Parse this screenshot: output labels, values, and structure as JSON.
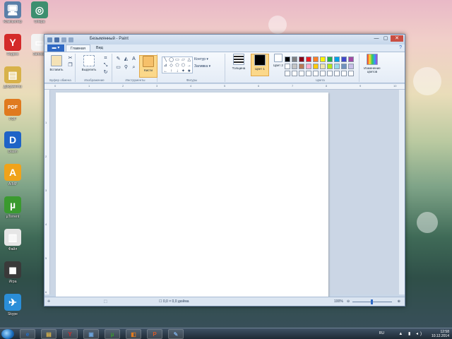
{
  "desktop": {
    "icons": [
      {
        "label": "Компьютер",
        "glyph": "🖥",
        "color": "#5a7fa8",
        "name": "computer"
      },
      {
        "label": "Яндекс",
        "glyph": "Y",
        "color": "#d42a2a",
        "name": "yandex"
      },
      {
        "label": "Документы",
        "glyph": "▤",
        "color": "#d8b24a",
        "name": "documents"
      },
      {
        "label": "PDF",
        "glyph": "PDF",
        "color": "#e07a1f",
        "name": "pdf"
      },
      {
        "label": "Daum",
        "glyph": "D",
        "color": "#1e63c7",
        "name": "daum"
      },
      {
        "label": "AIMP",
        "glyph": "A",
        "color": "#f0a31a",
        "name": "aimp"
      },
      {
        "label": "µTorrent",
        "glyph": "µ",
        "color": "#3a9a2f",
        "name": "utorrent"
      },
      {
        "label": "Файл",
        "glyph": "▥",
        "color": "#e6e6e6",
        "name": "file"
      },
      {
        "label": "Игра",
        "glyph": "◼",
        "color": "#3a3a3a",
        "name": "game"
      },
      {
        "label": "Skype",
        "glyph": "✈",
        "color": "#2a8ed8",
        "name": "skype"
      }
    ],
    "icons_col2": [
      {
        "label": "Опера",
        "glyph": "◎",
        "color": "#3d8f6f",
        "name": "browser"
      },
      {
        "label": "Записки",
        "glyph": "▭",
        "color": "#f3f3f3",
        "name": "notes"
      }
    ]
  },
  "window": {
    "title": "Безымянный - Paint",
    "controls": {
      "minimize": "—",
      "maximize": "▢",
      "close": "✕"
    },
    "tabs": {
      "file": "▬ ▾",
      "home": "Главная",
      "view": "Вид"
    },
    "help": "?"
  },
  "ribbon": {
    "groups": {
      "clipboard": "Буфер обмена",
      "image": "Изображение",
      "tools": "Инструменты",
      "shapes": "Фигуры",
      "colors": "Цвета"
    },
    "buttons": {
      "paste": "Вставить",
      "select": "Выделить",
      "brushes": "Кисти",
      "outline": "Контур ▾",
      "fill": "Заливка ▾",
      "size": "Толщина",
      "color1": "Цвет 1",
      "color2": "Цвет 2",
      "edit_colors": "Изменение цветов"
    },
    "shapes": [
      "╲",
      "◯",
      "▭",
      "▱",
      "△",
      "⊿",
      "◇",
      "⬠",
      "⬡",
      "→",
      "←",
      "↑",
      "↓",
      "✦",
      "★"
    ],
    "palette_row1": [
      "#000000",
      "#7f7f7f",
      "#880015",
      "#ed1c24",
      "#ff7f27",
      "#fff200",
      "#22b14c",
      "#00a2e8",
      "#3f48cc",
      "#a349a4"
    ],
    "palette_row2": [
      "#ffffff",
      "#c3c3c3",
      "#b97a57",
      "#ffaec9",
      "#ffc90e",
      "#efe4b0",
      "#b5e61d",
      "#99d9ea",
      "#7092be",
      "#c8bfe7"
    ],
    "color1_swatch": "#000000",
    "color2_swatch": "#ffffff"
  },
  "rulers": {
    "top": [
      "0",
      "1",
      "2",
      "3",
      "4",
      "5",
      "6",
      "7",
      "8",
      "9",
      "10"
    ],
    "left": [
      "1",
      "2",
      "3",
      "4",
      "5",
      "6"
    ]
  },
  "statusbar": {
    "cursor": "✛",
    "selection": "⬚",
    "canvas_size": "☐ 0,0 × 0,0 дюйма",
    "zoom": "100%",
    "zoom_out": "⊖",
    "zoom_in": "⊕"
  },
  "taskbar": {
    "items": [
      {
        "glyph": "e",
        "color": "#1e6fd0",
        "name": "ie"
      },
      {
        "glyph": "▤",
        "color": "#d8b24a",
        "name": "explorer"
      },
      {
        "glyph": "Y",
        "color": "#d42a2a",
        "name": "yandex"
      },
      {
        "glyph": "▣",
        "color": "#6aa0d8",
        "name": "app"
      },
      {
        "glyph": "µ",
        "color": "#3a9a2f",
        "name": "utorrent"
      },
      {
        "glyph": "◧",
        "color": "#e07a1f",
        "name": "pdf"
      },
      {
        "glyph": "P",
        "color": "#d45a2a",
        "name": "powerpoint"
      },
      {
        "glyph": "✎",
        "color": "#7aa7d8",
        "name": "paint"
      }
    ],
    "lang": "RU",
    "tray_icons": "▲ ▮ ◂)",
    "time": "12:58",
    "date": "10.12.2014"
  }
}
